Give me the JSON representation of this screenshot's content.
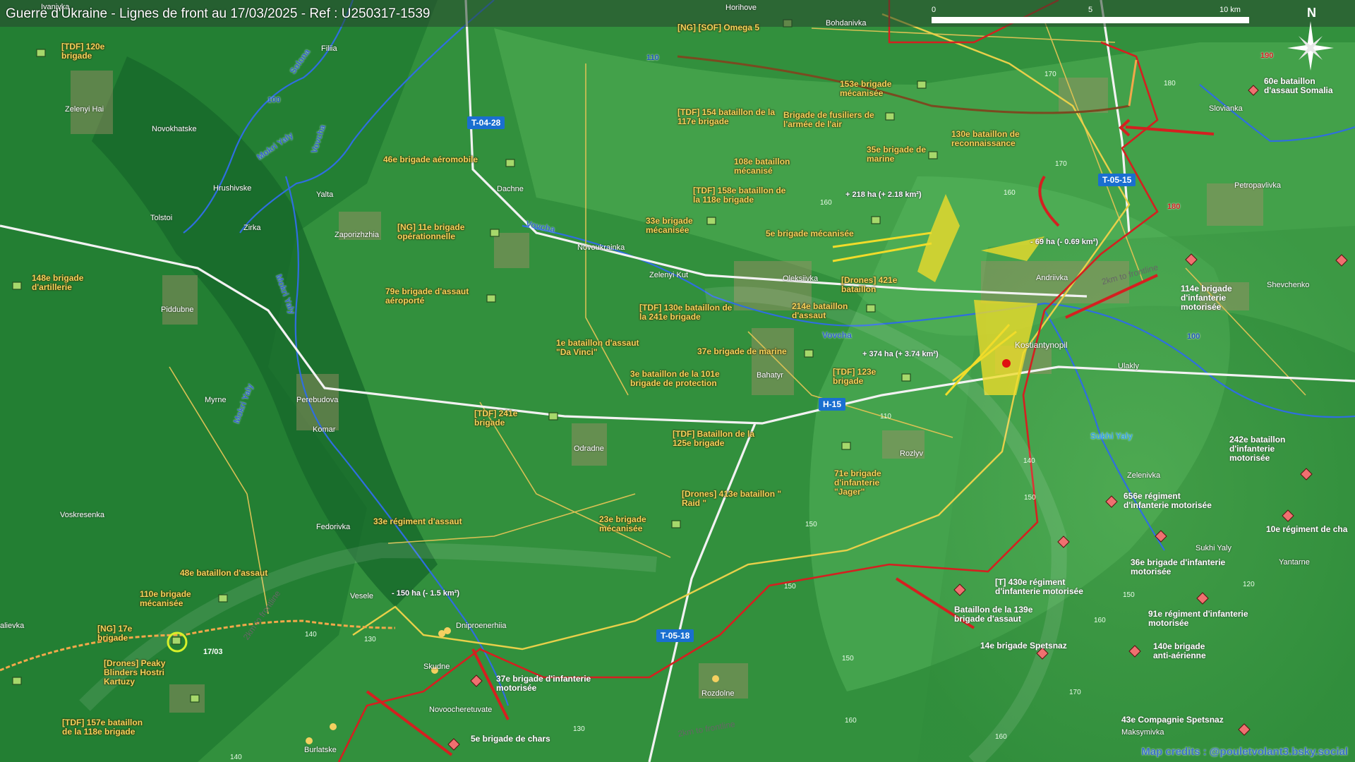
{
  "title": "Guerre d'Ukraine - Lignes de front au 17/03/2025 - Ref : U250317-1539",
  "scale": {
    "t0": "0",
    "t5": "5",
    "t10": "10 km"
  },
  "compass": {
    "n": "N"
  },
  "credits": "Map credits : @pouletvolant3.bsky.social",
  "date_marker": "17/03",
  "units": [
    "[TDF] 120e brigade",
    "[NG] [SOF] Omega 5",
    "148e brigade d'artillerie",
    "46e brigade aéromobile",
    "[NG] 11e brigade opérationnelle",
    "79e brigade d'assaut aéroporté",
    "153e brigade mécanisée",
    "[TDF] 154 bataillon de la 117e brigade",
    "Brigade de fusiliers de l'armée de l'air",
    "130e bataillon de reconnaissance",
    "35e brigade de marine",
    "108e bataillon mécanisé",
    "[TDF] 158e bataillon de la 118e brigade",
    "33e brigade mécanisée",
    "5e brigade mécanisée",
    "[Drones] 421e bataillon",
    "214e bataillon d'assaut",
    "[TDF] 130e bataillon de la 241e brigade",
    "1e bataillon d'assaut \"Da Vinci\"",
    "37e brigade de marine",
    "3e bataillon de la 101e brigade de protection",
    "[TDF] 123e brigade",
    "[TDF] 241e brigade",
    "[TDF] Bataillon de la 125e brigade",
    "71e brigade d'infanterie \"Jager\"",
    "[Drones] 413e bataillon \" Raid \"",
    "33e régiment d'assaut",
    "23e brigade mécanisée",
    "48e bataillon d'assaut",
    "110e brigade mécanisée",
    "[NG] 17e brigade",
    "[Drones] Peaky Blinders Hostri Kartuzy",
    "[TDF] 157e bataillon de la 118e brigade",
    "5e brigade de chars",
    "37e brigade d'infanterie motorisée",
    "60e bataillon d'assaut Somalia",
    "114e brigade d'infanterie motorisée",
    "242e bataillon d'infanterie motorisée",
    "656e régiment d'infanterie motorisée",
    "10e régiment de cha",
    "36e brigade d'infanterie motorisée",
    "[T] 430e régiment d'infanterie motorisée",
    "Bataillon de la 139e brigade d'assaut",
    "91e régiment d'infanterie motorisée",
    "14e brigade Spetsnaz",
    "140e brigade anti-aérienne",
    "43e Compagnie Spetsnaz"
  ],
  "towns": [
    "Ivanivka",
    "Horihove",
    "Bohdanivka",
    "Filiia",
    "Zelenyi Hai",
    "Novokhatske",
    "Hrushivske",
    "Tolstoi",
    "Yalta",
    "Zirka",
    "Zaporizhzhia",
    "Dachne",
    "Novoukrainka",
    "Zelenyi Kut",
    "Oleksiivka",
    "Andriivka",
    "Kostiantynopil",
    "Bahatyr",
    "Ulakly",
    "Piddubne",
    "Myrne",
    "Perebudova",
    "Komar",
    "Odradne",
    "Rozlyv",
    "Slovianka",
    "Petropavlivka",
    "Shevchenko",
    "Zelenivka",
    "Sukhi Yaly",
    "Yantarne",
    "Voskresenka",
    "Fedorivka",
    "Vesele",
    "Dniproenerhiia",
    "Skudne",
    "Novoocheretuvate",
    "Rozdolne",
    "Burlatske",
    "Maksymivka",
    "alievka"
  ],
  "rivers": [
    "Solona",
    "Mokri Yaly",
    "Vovcha",
    "Sukhi Yaly"
  ],
  "roads": [
    "T-04-28",
    "T-05-15",
    "H-15",
    "T-05-18"
  ],
  "road_numbers": [
    "110",
    "100",
    "190",
    "180",
    "100"
  ],
  "gains": [
    "+ 218 ha (+ 2.18 km²)",
    "- 69 ha (- 0.69 km²)",
    "+ 374 ha (+ 3.74 km²)",
    "- 150 ha (- 1.5 km²)"
  ],
  "frontline_buffer": "2km to frontline",
  "elevations": [
    "170",
    "180",
    "170",
    "160",
    "160",
    "110",
    "140",
    "150",
    "150",
    "130",
    "140",
    "150",
    "160",
    "150",
    "170",
    "160",
    "120",
    "160",
    "150",
    "130",
    "140"
  ],
  "colors": {
    "frontline_ua": "#e8d04a",
    "frontline_ru": "#d42020",
    "ua_units": "#a6d86b",
    "ru_units": "#f07070",
    "gain_area": "#f0dc2a"
  }
}
